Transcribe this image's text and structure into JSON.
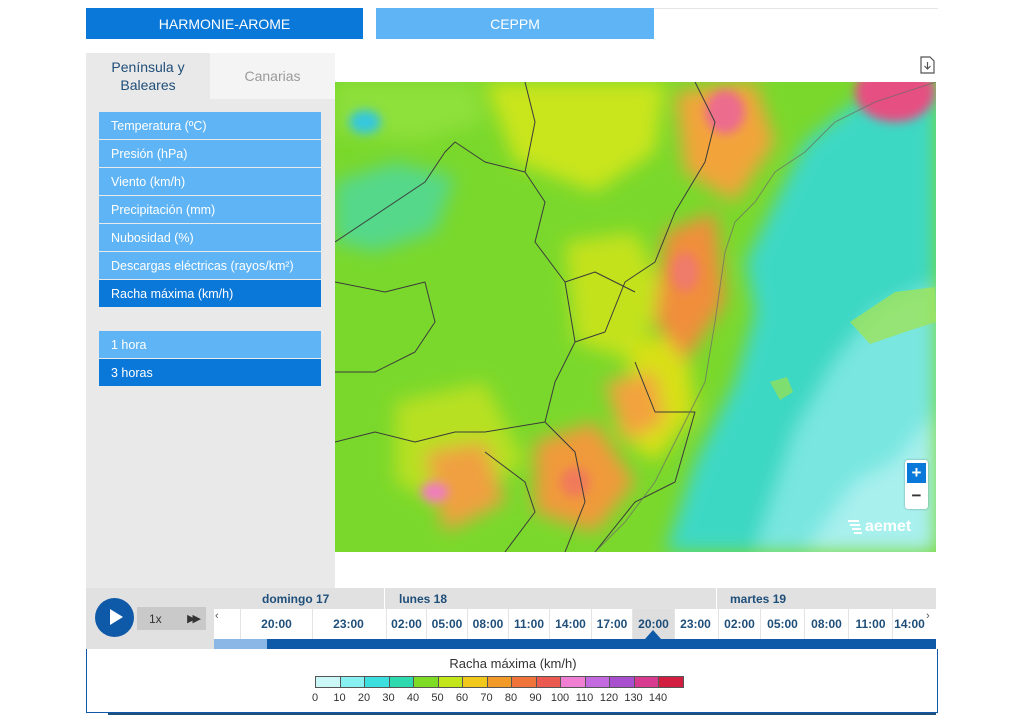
{
  "model_tabs": {
    "harmonie": "HARMONIE-AROME",
    "ceppm": "CEPPM"
  },
  "region_tabs": {
    "peninsula": "Península y Baleares",
    "canarias": "Canarias"
  },
  "variables": [
    {
      "label": "Temperatura (ºC)",
      "active": false
    },
    {
      "label": "Presión (hPa)",
      "active": false
    },
    {
      "label": "Viento (km/h)",
      "active": false
    },
    {
      "label": "Precipitación (mm)",
      "active": false
    },
    {
      "label": "Nubosidad (%)",
      "active": false
    },
    {
      "label": "Descargas eléctricas (rayos/km²)",
      "active": false
    },
    {
      "label": "Racha máxima (km/h)",
      "active": true
    }
  ],
  "intervals": [
    {
      "label": "1 hora",
      "active": false
    },
    {
      "label": "3 horas",
      "active": true
    }
  ],
  "map": {
    "logo_text": "aemet",
    "zoom_in": "+",
    "zoom_out": "−"
  },
  "timeline": {
    "speed": "1x",
    "days": [
      "domingo 17",
      "lunes 18",
      "martes 19"
    ],
    "hours": [
      "20:00",
      "23:00",
      "02:00",
      "05:00",
      "08:00",
      "11:00",
      "14:00",
      "17:00",
      "20:00",
      "23:00",
      "02:00",
      "05:00",
      "08:00",
      "11:00",
      "14:00"
    ],
    "selected_hour_index": 8
  },
  "legend": {
    "title": "Racha máxima (km/h)",
    "values": [
      "0",
      "10",
      "20",
      "30",
      "40",
      "50",
      "60",
      "70",
      "80",
      "90",
      "100",
      "110",
      "120",
      "130",
      "140"
    ],
    "colors": [
      "#ccf7f7",
      "#88f0f0",
      "#3ddede",
      "#2ed9b0",
      "#7edc26",
      "#c3e61a",
      "#f0c81c",
      "#f29a28",
      "#f0743a",
      "#eb5a50",
      "#f07ed2",
      "#c46ae0",
      "#a84fcf",
      "#d83a90",
      "#d11d40"
    ]
  },
  "colors": {
    "primary": "#0a78d8",
    "secondary": "#5fb4f5",
    "dark": "#0f5aa8"
  }
}
